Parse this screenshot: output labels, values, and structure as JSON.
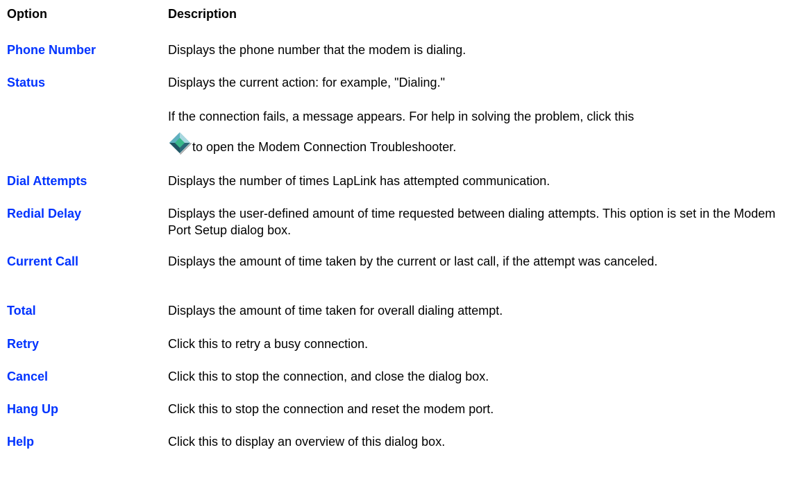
{
  "headers": {
    "option": "Option",
    "description": "Description"
  },
  "colors": {
    "link": "#0033ff",
    "text": "#000000",
    "background": "#ffffff"
  },
  "rows": [
    {
      "option": "Phone Number",
      "description": "Displays the phone number that the modem is dialing."
    },
    {
      "option": "Status",
      "description": "Displays the current action: for example, \"Dialing.\"",
      "extra_text": "If the connection fails, a message appears. For help in solving the problem, click this",
      "icon": "troubleshooter-diamond-icon",
      "icon_suffix": "to open the Modem Connection Troubleshooter."
    },
    {
      "option": "Dial Attempts",
      "description": "Displays the number of times LapLink has attempted communication."
    },
    {
      "option": "Redial Delay",
      "description": "Displays the user-defined amount of time requested between dialing attempts. This option is set in the Modem Port Setup dialog box."
    },
    {
      "option": "Current Call",
      "description": "Displays the amount of time taken by the current or last call, if the attempt was canceled."
    },
    {
      "option": "Total",
      "description": "Displays the amount of time taken for overall dialing attempt."
    },
    {
      "option": "Retry",
      "description": "Click this to retry a busy connection."
    },
    {
      "option": "Cancel",
      "description": "Click this to stop the connection, and close the dialog box."
    },
    {
      "option": "Hang Up",
      "description": "Click this to stop the connection and reset the modem port."
    },
    {
      "option": "Help",
      "description": "Click this to display an overview of this dialog box."
    }
  ]
}
